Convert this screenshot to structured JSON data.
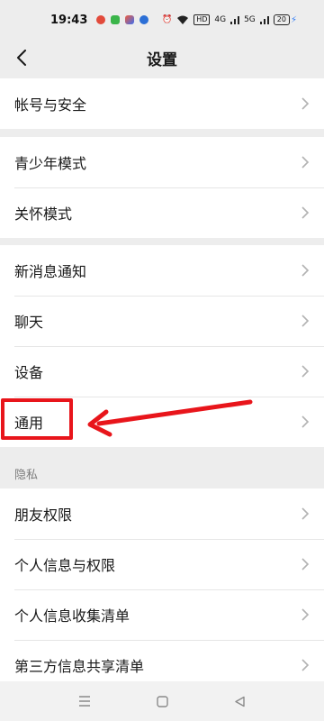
{
  "status_bar": {
    "time": "19:43",
    "hd_label": "HD",
    "signal1": "4G",
    "signal2": "5G",
    "battery": "20"
  },
  "header": {
    "title": "设置"
  },
  "groups": [
    {
      "items": [
        {
          "label": "帐号与安全"
        }
      ]
    },
    {
      "items": [
        {
          "label": "青少年模式"
        },
        {
          "label": "关怀模式"
        }
      ]
    },
    {
      "items": [
        {
          "label": "新消息通知"
        },
        {
          "label": "聊天"
        },
        {
          "label": "设备"
        },
        {
          "label": "通用"
        }
      ]
    },
    {
      "section_label": "隐私",
      "items": [
        {
          "label": "朋友权限"
        },
        {
          "label": "个人信息与权限"
        },
        {
          "label": "个人信息收集清单"
        },
        {
          "label": "第三方信息共享清单"
        }
      ]
    }
  ],
  "annotation": {
    "color": "#e8151b",
    "target": "通用"
  },
  "colors": {
    "background": "#ededed",
    "row_bg": "#ffffff",
    "chevron": "#b2b2b2",
    "section_text": "#7d7d7d"
  },
  "icons": [
    "back-chevron-icon",
    "chevron-right-icon",
    "menu-icon",
    "home-icon",
    "back-triangle-icon"
  ]
}
